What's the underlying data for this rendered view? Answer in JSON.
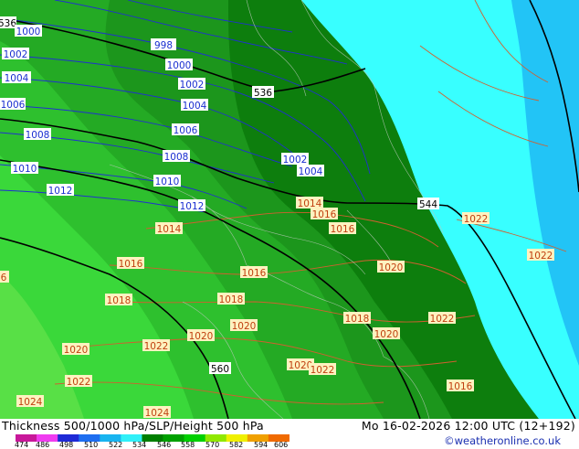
{
  "header": {
    "title": "Thickness 500/1000 hPa/SLP/Height 500 hPa",
    "valid_time": "Mo 16-02-2026 12:00 UTC (12+192)"
  },
  "credit": "©weatheronline.co.uk",
  "legend": {
    "ticks": [
      "474",
      "486",
      "498",
      "510",
      "522",
      "534",
      "546",
      "558",
      "570",
      "582",
      "594",
      "606"
    ],
    "colors": [
      "#c8189a",
      "#f03cf0",
      "#1e2ad6",
      "#1e6ef0",
      "#18b4f0",
      "#30f0f8",
      "#007e00",
      "#00a000",
      "#00d000",
      "#90e800",
      "#f0f000",
      "#f0a000",
      "#f06a00"
    ]
  },
  "map": {
    "fill_colors": {
      "band_534_546": "#38ffff",
      "band_522_534": "#20c8f8",
      "band_546_552": "#107e10",
      "band_546": "#0a7a0a",
      "band_552": "#1a9a1a",
      "band_558": "#22b222",
      "band_564": "#2cc42c",
      "band_570": "#36d836"
    },
    "isobar_colors": {
      "sea": "#2030d0",
      "land": "#d06030"
    },
    "height_labels": [
      "536",
      "536",
      "544",
      "560"
    ],
    "isobar_labels_blue": [
      "1000",
      "998",
      "1000",
      "1002",
      "1002",
      "1004",
      "1004",
      "1002",
      "1006",
      "1004",
      "1006",
      "1008",
      "1008",
      "1010",
      "1010",
      "1010",
      "1012",
      "1012",
      "1012"
    ],
    "isobar_labels_orange": [
      "1014",
      "1014",
      "1016",
      "1016",
      "1016",
      "1016",
      "1018",
      "1018",
      "1018",
      "1020",
      "1020",
      "1020",
      "1020",
      "1020",
      "1020",
      "1022",
      "1022",
      "1022",
      "1022",
      "1022",
      "1022",
      "1024",
      "1024",
      "1016"
    ]
  }
}
